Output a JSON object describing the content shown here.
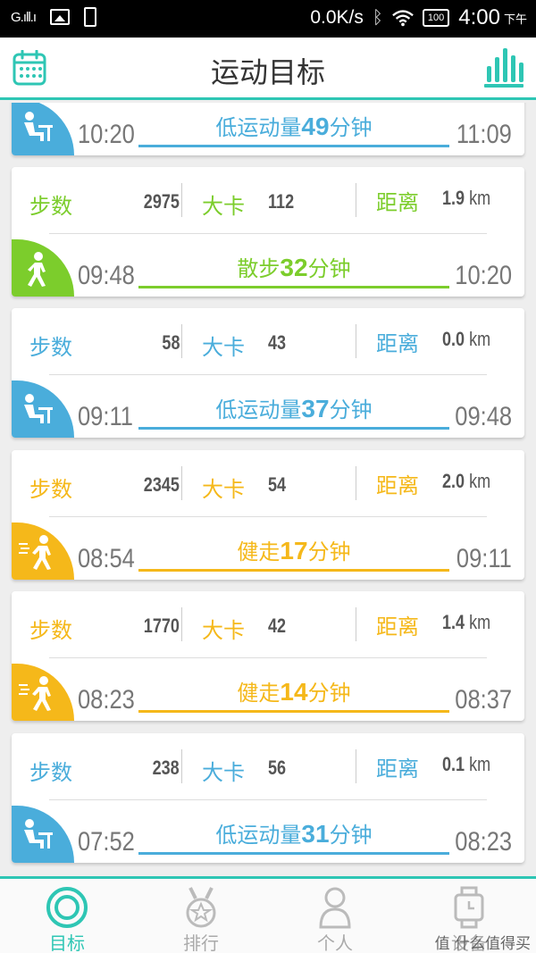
{
  "statusbar": {
    "signal": "G.ıll.ı",
    "network_speed": "0.0K/s",
    "battery": "100",
    "time": "4:00",
    "ampm": "下午"
  },
  "header": {
    "title": "运动目标",
    "left_icon": "calendar-icon",
    "right_icon": "bar-chart-icon"
  },
  "colors": {
    "accent": "#2ec6b4",
    "sedentary": "#4aaddb",
    "walk": "#7ccd2c",
    "brisk": "#f5b81a"
  },
  "labels": {
    "steps": "步数",
    "calories": "大卡",
    "distance": "距离",
    "km": "km",
    "minutes": "分钟"
  },
  "cards": [
    {
      "type": "sedentary",
      "icon": "sitting-person-icon",
      "activity": "低运动量",
      "minutes": "49",
      "start": "10:20",
      "end": "11:09",
      "partial": true
    },
    {
      "type": "walk",
      "icon": "walking-person-icon",
      "activity": "散步",
      "minutes": "32",
      "start": "09:48",
      "end": "10:20",
      "steps": "2975",
      "calories": "112",
      "distance": "1.9"
    },
    {
      "type": "sedentary",
      "icon": "sitting-person-icon",
      "activity": "低运动量",
      "minutes": "37",
      "start": "09:11",
      "end": "09:48",
      "steps": "58",
      "calories": "43",
      "distance": "0.0"
    },
    {
      "type": "brisk",
      "icon": "running-person-icon",
      "activity": "健走",
      "minutes": "17",
      "start": "08:54",
      "end": "09:11",
      "steps": "2345",
      "calories": "54",
      "distance": "2.0"
    },
    {
      "type": "brisk",
      "icon": "running-person-icon",
      "activity": "健走",
      "minutes": "14",
      "start": "08:23",
      "end": "08:37",
      "steps": "1770",
      "calories": "42",
      "distance": "1.4"
    },
    {
      "type": "sedentary",
      "icon": "sitting-person-icon",
      "activity": "低运动量",
      "minutes": "31",
      "start": "07:52",
      "end": "08:23",
      "steps": "238",
      "calories": "56",
      "distance": "0.1"
    }
  ],
  "bottom_nav": [
    {
      "label": "目标",
      "icon": "target-icon",
      "active": true
    },
    {
      "label": "排行",
      "icon": "medal-icon",
      "active": false
    },
    {
      "label": "个人",
      "icon": "person-icon",
      "active": false
    },
    {
      "label": "设备",
      "icon": "watch-icon",
      "active": false
    }
  ],
  "watermark": "值 什么值得买"
}
